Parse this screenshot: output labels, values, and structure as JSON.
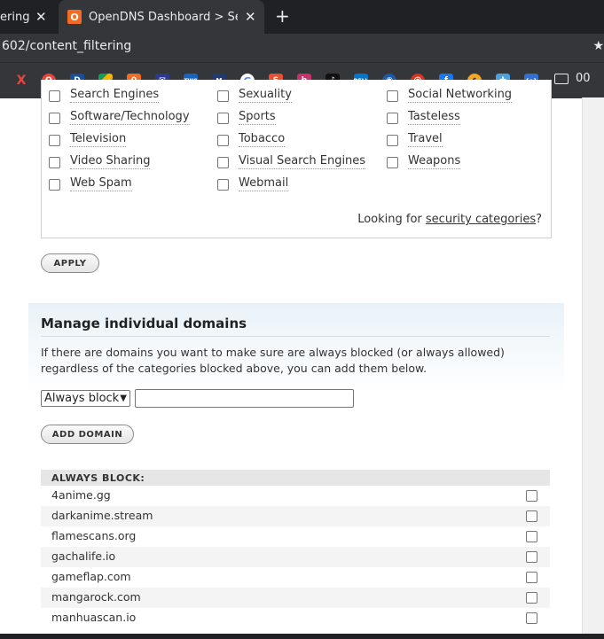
{
  "browser": {
    "tab1_title": "ering",
    "tab2_title": "OpenDNS Dashboard > Setting",
    "tab2_favicon": "O",
    "new_tab": "+",
    "close": "✕",
    "url": "602/content_filtering",
    "bookmark_folder_label": "00"
  },
  "categories": {
    "rows": [
      [
        "Search Engines",
        "Sexuality",
        "Social Networking"
      ],
      [
        "Software/Technology",
        "Sports",
        "Tasteless"
      ],
      [
        "Television",
        "Tobacco",
        "Travel"
      ],
      [
        "Video Sharing",
        "Visual Search Engines",
        "Weapons"
      ],
      [
        "Web Spam",
        "Webmail",
        ""
      ]
    ],
    "security_prefix": "Looking for ",
    "security_link": "security categories",
    "security_suffix": "?"
  },
  "apply_button": "APPLY",
  "manage": {
    "title": "Manage individual domains",
    "description": "If there are domains you want to make sure are always blocked (or always allowed) regardless of the categories blocked above, you can add them below.",
    "select_value": "Always block",
    "domain_input_value": "",
    "add_button": "ADD DOMAIN"
  },
  "block_list": {
    "header": "ALWAYS BLOCK:",
    "domains": [
      "4anime.gg",
      "darkanime.stream",
      "flamescans.org",
      "gachalife.io",
      "gameflap.com",
      "mangarock.com",
      "manhuascan.io"
    ]
  },
  "colors": {
    "chrome_dark": "#202124",
    "chrome_mid": "#35363a",
    "opendns_orange": "#f36c21",
    "manage_bg": "#e9f2f8"
  }
}
